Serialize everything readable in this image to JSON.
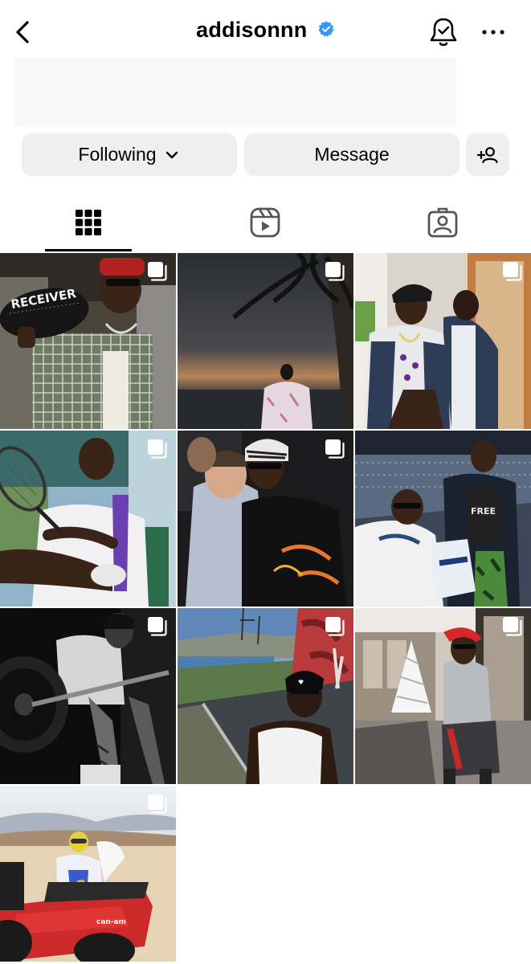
{
  "header": {
    "username": "addisonnn",
    "icons": {
      "back": "chevron-left-icon",
      "verified": "verified-badge-icon",
      "notifications": "bell-check-icon",
      "more": "more-horizontal-icon"
    }
  },
  "actions": {
    "following_label": "Following",
    "message_label": "Message",
    "suggest_icon": "add-person-icon"
  },
  "tabs": [
    {
      "name": "posts",
      "icon": "grid-icon",
      "active": true
    },
    {
      "name": "reels",
      "icon": "reels-icon",
      "active": false
    },
    {
      "name": "tagged",
      "icon": "tagged-person-icon",
      "active": false
    }
  ],
  "colors": {
    "accent": "#3897f0",
    "button_bg": "#efefef",
    "text": "#000000"
  },
  "grid": {
    "posts": [
      {
        "overlay_text": "RECEIVER",
        "multi": true
      },
      {
        "multi": true
      },
      {
        "multi": true
      },
      {
        "multi": true
      },
      {
        "multi": true
      },
      {
        "overlay_text": "FREE",
        "multi": false
      },
      {
        "multi": true
      },
      {
        "multi": true
      },
      {
        "multi": true
      },
      {
        "overlay_text": "can-am",
        "multi": true
      }
    ]
  }
}
